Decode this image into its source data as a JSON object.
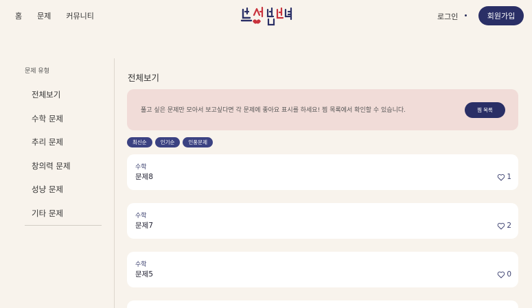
{
  "header": {
    "nav": [
      "홈",
      "문제",
      "커뮤니티"
    ],
    "logo_text": "뇌섹남녀",
    "login_label": "로그인",
    "signup_label": "회원가입"
  },
  "sidebar": {
    "title": "문제 유형",
    "items": [
      "전체보기",
      "수학 문제",
      "추리 문제",
      "창의력 문제",
      "성냥 문제",
      "기타 문제"
    ]
  },
  "main": {
    "title": "전체보기",
    "banner_text": "풀고 싶은 문제만 모아서 보고싶다면 각 문제에 좋아요 표시를 하세요! 찜 목록에서 확인할 수 있습니다.",
    "wishlist_label": "찜 목록",
    "sort_options": [
      "최신순",
      "인기순",
      "인풍문제"
    ],
    "problems": [
      {
        "category": "수학",
        "title": "문제8",
        "likes": "1"
      },
      {
        "category": "수학",
        "title": "문제7",
        "likes": "2"
      },
      {
        "category": "수학",
        "title": "문제5",
        "likes": "0"
      }
    ]
  },
  "colors": {
    "background": "#f8f3ec",
    "accent": "#2a2f66",
    "banner": "#f1dcd8",
    "logo_red": "#c8323c",
    "logo_navy": "#2a2f66"
  },
  "icons": [
    "heart-icon"
  ]
}
